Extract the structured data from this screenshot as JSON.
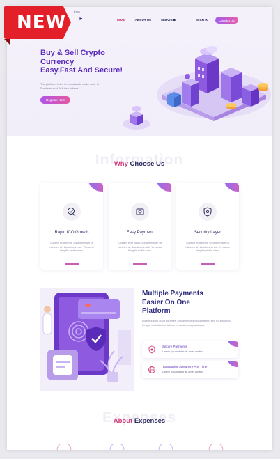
{
  "badge": {
    "label": "NEW"
  },
  "header": {
    "logo_sub": "trans",
    "logo_tail": "E",
    "nav": [
      "HOME",
      "ABOUT US",
      "SERVICE"
    ],
    "signin": "SIGN IN",
    "contact": "Contact Us"
  },
  "hero": {
    "title_lines": [
      "Buy & Sell Crypto",
      "Currency",
      "Easy,Fast And Secure!"
    ],
    "desc": "The platform helps to investors to make easy to Purchase and Sell their tokens",
    "button": "Register Now"
  },
  "why": {
    "bg_text": "Information",
    "title_hl": "Why",
    "title_rest": "Choose Us",
    "cards": [
      {
        "title": "Rapid ICO Growth",
        "text": "Culatbt erat tortor, condimentum ut ultricies at, faucibus in dui. Vi varius fringilla mollis sem.",
        "icon": "coin-growth-icon"
      },
      {
        "title": "Easy Payment",
        "text": "Culatbt erat tortor, condimentum ut ultricies at, faucibus in dui. Vi varius fringilla mollis sem.",
        "icon": "wallet-icon"
      },
      {
        "title": "Security Layer",
        "text": "Culatbt erat tortor, condimentum ut ultricies at, faucibus in dui. Vi varius fringilla mollis sem.",
        "icon": "shield-icon"
      }
    ]
  },
  "payments": {
    "title_lines": [
      "Multiple Payments",
      "Easier On One",
      "Platform"
    ],
    "desc": "Lorem ipsum dolor sit amet, consectetur adipiscing elit, sed do eiusmod tempor incididunt ut labore et dolore magna aliqua.",
    "features": [
      {
        "title": "Secure Payments",
        "sub": "Lorem ipsum dolor sit amet contect",
        "icon": "secure-shield-icon"
      },
      {
        "title": "Transaction Anywhere Any Time",
        "sub": "Lorem ipsum dolor sit amet contect",
        "icon": "globe-icon"
      }
    ]
  },
  "about": {
    "bg_text": "Expenses",
    "title_hl": "About",
    "title_rest": "Expenses"
  },
  "colors": {
    "accent": "#5a2ab9",
    "pink": "#d23b78",
    "ribbon": "#e3202a"
  }
}
